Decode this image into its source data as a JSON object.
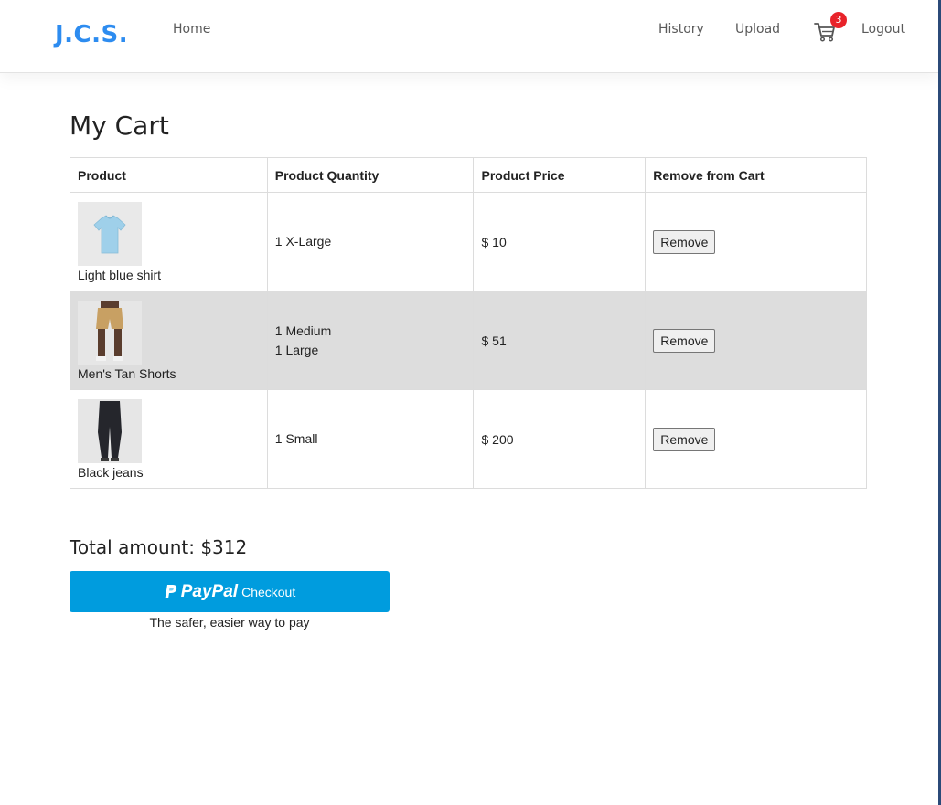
{
  "nav": {
    "brand": "J.C.S.",
    "home": "Home",
    "history": "History",
    "upload": "Upload",
    "cart_count": "3",
    "logout": "Logout",
    "brand_color": "#2d8cf0",
    "badge_color": "#e8232a",
    "cart_icon": "shopping-cart-icon"
  },
  "cart": {
    "title": "My Cart",
    "columns": [
      "Product",
      "Product Quantity",
      "Product Price",
      "Remove from Cart"
    ],
    "items": [
      {
        "name": "Light blue shirt",
        "qty": [
          "1 X-Large"
        ],
        "price": "$ 10",
        "remove": "Remove"
      },
      {
        "name": "Men's Tan Shorts",
        "qty": [
          "1 Medium",
          "1 Large"
        ],
        "price": "$ 51",
        "remove": "Remove"
      },
      {
        "name": "Black jeans",
        "qty": [
          "1 Small"
        ],
        "price": "$ 200",
        "remove": "Remove"
      }
    ],
    "total": "Total amount: $312"
  },
  "paypal": {
    "brand": "PayPal",
    "label": "Checkout",
    "tagline": "The safer, easier way to pay",
    "color": "#009cde"
  }
}
